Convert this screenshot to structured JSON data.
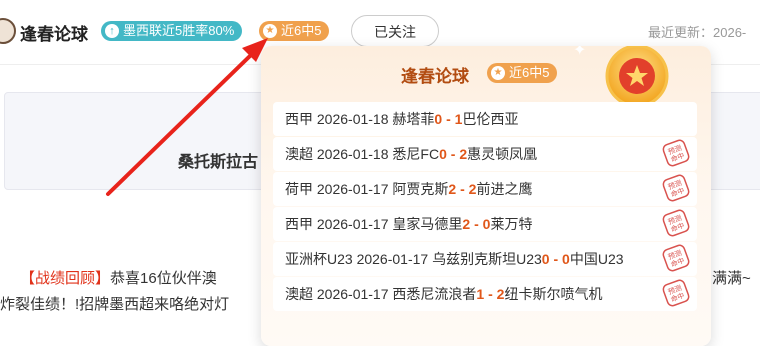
{
  "header": {
    "author": "逢春论球",
    "stat_badge": "墨西联近5胜率80%",
    "recent_badge": "近6中5",
    "follow_label": "已关注",
    "update_text": "最近更新：2026-"
  },
  "article": {
    "title_partial": "桑托斯拉古"
  },
  "recap": {
    "label": "【战绩回顾】",
    "line1": "恭喜16位伙伴澳",
    "line1_tail": "满满~",
    "line2": "炸裂佳绩！!招牌墨西超来咯绝对灯"
  },
  "popup": {
    "title": "逢春论球",
    "badge": "近6中5",
    "stamp_text": "预测命中",
    "matches": [
      {
        "league": "西甲",
        "date": "2026-01-18",
        "home": "赫塔菲",
        "home_score": "0",
        "sep": " - ",
        "away_score": "1",
        "away": "巴伦西亚",
        "hit": false
      },
      {
        "league": "澳超",
        "date": "2026-01-18",
        "home": "悉尼FC",
        "home_score": "0",
        "sep": " - ",
        "away_score": "2",
        "away": "惠灵顿凤凰",
        "hit": true
      },
      {
        "league": "荷甲",
        "date": "2026-01-17",
        "home": "阿贾克斯",
        "home_score": "2",
        "sep": " - ",
        "away_score": "2",
        "away": "前进之鹰",
        "hit": true
      },
      {
        "league": "西甲",
        "date": "2026-01-17",
        "home": "皇家马德里",
        "home_score": "2",
        "sep": " - ",
        "away_score": "0",
        "away": "莱万特",
        "hit": true
      },
      {
        "league": "亚洲杯U23",
        "date": "2026-01-17",
        "home": "乌兹别克斯坦U23",
        "home_score": "0",
        "sep": " - ",
        "away_score": "0",
        "away": "中国U23",
        "hit": true
      },
      {
        "league": "澳超",
        "date": "2026-01-17",
        "home": "西悉尼流浪者",
        "home_score": "1",
        "sep": " - ",
        "away_score": "2",
        "away": "纽卡斯尔喷气机",
        "hit": true
      }
    ]
  },
  "colors": {
    "accent_red": "#e0321a",
    "score_orange": "#e0571a",
    "badge_orange": "#f0a14d",
    "badge_teal": "#43b8c6",
    "stamp_red": "#d9534f"
  }
}
